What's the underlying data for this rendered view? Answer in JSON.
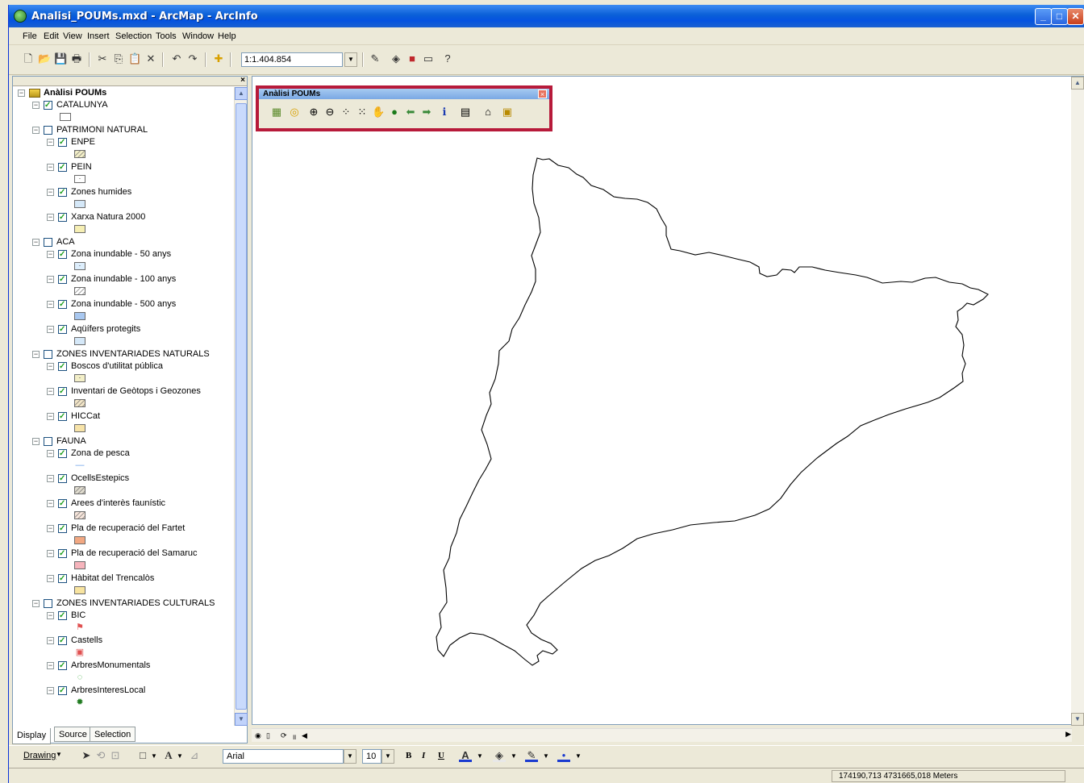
{
  "window": {
    "title": "Analisi_POUMs.mxd - ArcMap - ArcInfo"
  },
  "menu": [
    "File",
    "Edit",
    "View",
    "Insert",
    "Selection",
    "Tools",
    "Window",
    "Help"
  ],
  "toolbar": {
    "scale": "1:1.404.854"
  },
  "toc": {
    "root": "Anàlisi POUMs",
    "items": [
      {
        "label": "CATALUNYA",
        "level": 1,
        "checked": true,
        "symbol": {
          "fill": "#ffffff",
          "pattern": "none"
        }
      },
      {
        "label": "PATRIMONI NATURAL",
        "level": 1,
        "checked": false
      },
      {
        "label": "ENPE",
        "level": 2,
        "checked": true,
        "symbol": {
          "fill": "#f3efc8",
          "pattern": "hatch"
        }
      },
      {
        "label": "PEIN",
        "level": 2,
        "checked": true,
        "symbol": {
          "fill": "#ffffff",
          "pattern": "dot"
        }
      },
      {
        "label": "Zones humides",
        "level": 2,
        "checked": true,
        "symbol": {
          "fill": "#d5e8f8",
          "pattern": "none"
        }
      },
      {
        "label": "Xarxa Natura 2000",
        "level": 2,
        "checked": true,
        "symbol": {
          "fill": "#f6efb4",
          "pattern": "none"
        }
      },
      {
        "label": "ACA",
        "level": 1,
        "checked": false
      },
      {
        "label": "Zona inundable - 50 anys",
        "level": 2,
        "checked": true,
        "symbol": {
          "fill": "#ddeefc",
          "pattern": "dot"
        }
      },
      {
        "label": "Zona inundable - 100 anys",
        "level": 2,
        "checked": true,
        "symbol": {
          "fill": "#ffffff",
          "pattern": "hatch"
        }
      },
      {
        "label": "Zona inundable - 500 anys",
        "level": 2,
        "checked": true,
        "symbol": {
          "fill": "#a9c8f0",
          "pattern": "none"
        }
      },
      {
        "label": "Aqüífers protegits",
        "level": 2,
        "checked": true,
        "symbol": {
          "fill": "#d5e8f8",
          "pattern": "none"
        }
      },
      {
        "label": "ZONES INVENTARIADES NATURALS",
        "level": 1,
        "checked": false
      },
      {
        "label": "Boscos d'utilitat pública",
        "level": 2,
        "checked": true,
        "symbol": {
          "fill": "#f3efc8",
          "pattern": "dot"
        }
      },
      {
        "label": "Inventari de Geòtops i Geozones",
        "level": 2,
        "checked": true,
        "symbol": {
          "fill": "#f3e6c8",
          "pattern": "hatch"
        }
      },
      {
        "label": "HICCat",
        "level": 2,
        "checked": true,
        "symbol": {
          "fill": "#f7e3a8",
          "pattern": "none"
        }
      },
      {
        "label": "FAUNA",
        "level": 1,
        "checked": false
      },
      {
        "label": "Zona de pesca",
        "level": 2,
        "checked": true,
        "symbol": {
          "fill": "#6aa0e8",
          "pattern": "line"
        }
      },
      {
        "label": "OcellsEstepics",
        "level": 2,
        "checked": true,
        "symbol": {
          "fill": "#e0dccf",
          "pattern": "hatch"
        }
      },
      {
        "label": "Arees d'interès faunístic",
        "level": 2,
        "checked": true,
        "symbol": {
          "fill": "#f7e6dc",
          "pattern": "hatch"
        }
      },
      {
        "label": "Pla de recuperació del Fartet",
        "level": 2,
        "checked": true,
        "symbol": {
          "fill": "#f2a882",
          "pattern": "none"
        }
      },
      {
        "label": "Pla de recuperació del Samaruc",
        "level": 2,
        "checked": true,
        "symbol": {
          "fill": "#f6b4bc",
          "pattern": "none"
        }
      },
      {
        "label": "Hàbitat del Trencalòs",
        "level": 2,
        "checked": true,
        "symbol": {
          "fill": "#f8e4a0",
          "pattern": "none"
        }
      },
      {
        "label": "ZONES INVENTARIADES CULTURALS",
        "level": 1,
        "checked": false
      },
      {
        "label": "BIC",
        "level": 2,
        "checked": true,
        "symbol": {
          "fill": "#e05050",
          "pattern": "flag"
        }
      },
      {
        "label": "Castells",
        "level": 2,
        "checked": true,
        "symbol": {
          "fill": "#e05050",
          "pattern": "castle"
        }
      },
      {
        "label": "ArbresMonumentals",
        "level": 2,
        "checked": true,
        "symbol": {
          "fill": "#3aa83a",
          "pattern": "ring"
        }
      },
      {
        "label": "ArbresInteresLocal",
        "level": 2,
        "checked": true,
        "symbol": {
          "fill": "#1f7a1f",
          "pattern": "tree"
        }
      }
    ],
    "tabs": [
      "Display",
      "Source",
      "Selection"
    ]
  },
  "analisi_toolbar": {
    "title": "Anàlisi POUMs"
  },
  "drawing": {
    "label": "Drawing",
    "font": "Arial",
    "size": "10",
    "bold": "B",
    "italic": "I",
    "underline": "U"
  },
  "status": {
    "coords": "174190,713  4731665,018 Meters"
  }
}
